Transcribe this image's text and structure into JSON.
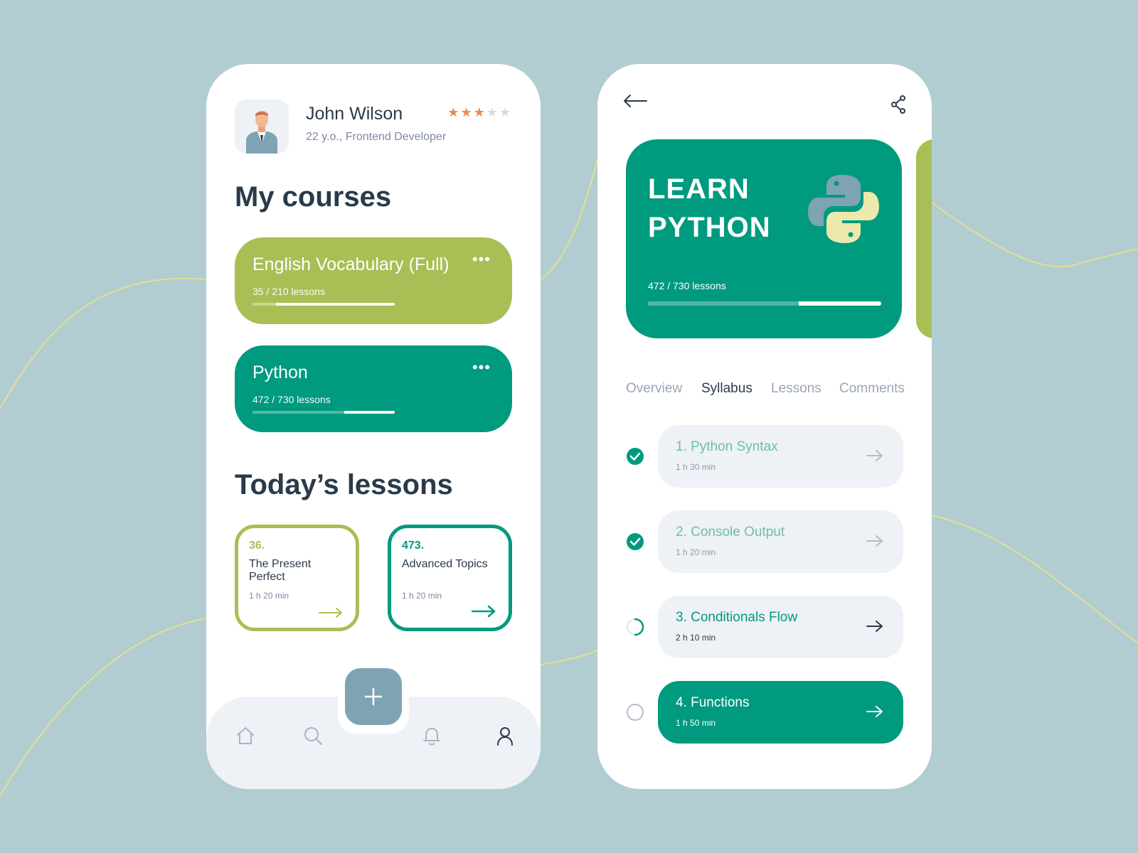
{
  "colors": {
    "background": "#b1cdd1",
    "accent_green": "#009a7f",
    "accent_lime": "#a8bf55",
    "fab": "#7ea4b4",
    "star": "#e58c4d"
  },
  "profile": {
    "name": "John Wilson",
    "subtitle": "22 y.o., Frontend Developer",
    "rating": 3,
    "rating_max": 5
  },
  "my_courses": {
    "title": "My courses",
    "courses": [
      {
        "title": "English Vocabulary (Full)",
        "lessons": "35 / 210 lessons",
        "progress": 0.167,
        "menu": "•••"
      },
      {
        "title": "Python",
        "lessons": "472 / 730 lessons",
        "progress": 0.647,
        "menu": "•••"
      }
    ]
  },
  "todays_lessons": {
    "title": "Today’s lessons",
    "lessons": [
      {
        "number": "36.",
        "name": "The Present Perfect",
        "duration": "1 h  20 min"
      },
      {
        "number": "473.",
        "name": "Advanced Topics",
        "duration": "1 h  20 min"
      }
    ]
  },
  "bottom_nav": {
    "items": [
      "home-icon",
      "search-icon",
      "bell-icon",
      "profile-icon"
    ],
    "active": "profile-icon",
    "fab_icon": "plus-icon"
  },
  "course_detail": {
    "hero_title_line1": "LEARN",
    "hero_title_line2": "PYTHON",
    "lessons": "472 / 730 lessons",
    "progress": 0.647,
    "tabs": [
      "Overview",
      "Syllabus",
      "Lessons",
      "Comments"
    ],
    "active_tab": 1,
    "syllabus": [
      {
        "title": "1. Python Syntax",
        "duration": "1 h  30 min",
        "status": "done"
      },
      {
        "title": "2. Console Output",
        "duration": "1 h  20 min",
        "status": "done"
      },
      {
        "title": "3. Conditionals Flow",
        "duration": "2 h  10 min",
        "status": "in-progress"
      },
      {
        "title": "4. Functions",
        "duration": "1 h  50 min",
        "status": "not-started"
      }
    ]
  }
}
